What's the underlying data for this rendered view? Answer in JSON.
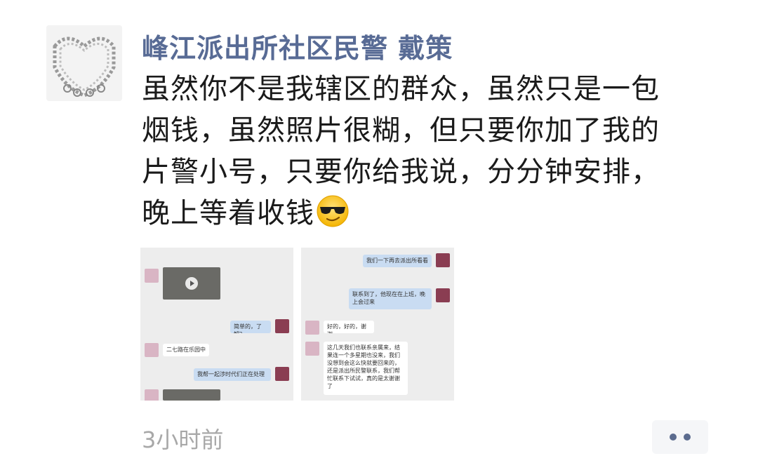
{
  "post": {
    "author": "峰江派出所社区民警 戴策",
    "text_lines": [
      "虽然你不是我辖区的群众，虽然只是一包",
      "烟钱，虽然照片很糊，但只要你加了我的",
      "片警小号，只要你给我说，分分钟安排，",
      "晚上等着收钱"
    ],
    "emoji": "sunglasses-smiling-face",
    "timestamp": "3小时前"
  },
  "photos": [
    {
      "name": "chat-screenshot-1",
      "messages": [
        {
          "side": "left",
          "type": "video"
        },
        {
          "side": "right",
          "text": "简单的，了解？"
        },
        {
          "side": "left",
          "text": "二七路在乐园中"
        },
        {
          "side": "right",
          "text": "我帮一起涉时代们正在处理"
        }
      ]
    },
    {
      "name": "chat-screenshot-2",
      "messages": [
        {
          "side": "right",
          "text": "我们一下再去派出所看看"
        },
        {
          "side": "right",
          "text": "联系到了，他现在在上班，晚上会过来"
        },
        {
          "side": "left",
          "text": "好的，好的，谢谢"
        },
        {
          "side": "left",
          "text": "这几天我们也联系亲属来，结果连一个多星期也没来，我们没想到会这么快就要回来的，还是派出所民警联系，我们帮忙联系下试试，真的是太谢谢了"
        }
      ]
    }
  ],
  "colors": {
    "author": "#586b95",
    "text": "#1a1a1a",
    "timestamp": "#a8a8a8",
    "more_dots": "#5b6b8e",
    "bubble_right": "#c9dcf2"
  }
}
